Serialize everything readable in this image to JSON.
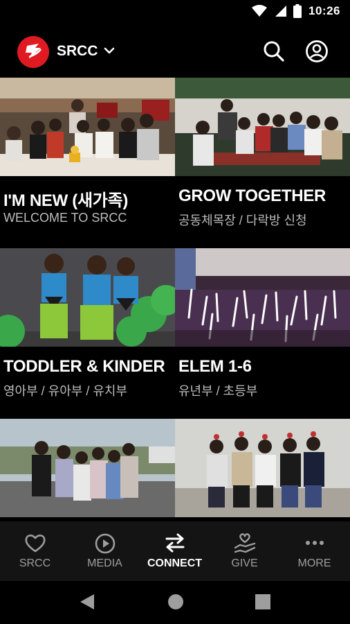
{
  "status_bar": {
    "time": "10:26"
  },
  "app_bar": {
    "app_name": "SRCC"
  },
  "cards": [
    {
      "title": "I'M NEW (새가족)",
      "subtitle": "WELCOME TO SRCC"
    },
    {
      "title": "GROW TOGETHER",
      "subtitle": "공동체목장 / 다락방 신청"
    },
    {
      "title": "TODDLER & KINDER",
      "subtitle": "영아부 / 유아부 / 유치부"
    },
    {
      "title": "ELEM 1-6",
      "subtitle": "유년부 / 초등부"
    },
    {
      "title": "",
      "subtitle": ""
    },
    {
      "title": "",
      "subtitle": ""
    }
  ],
  "bottom_nav": [
    {
      "label": "SRCC",
      "icon": "heart-icon"
    },
    {
      "label": "MEDIA",
      "icon": "play-icon"
    },
    {
      "label": "CONNECT",
      "icon": "swap-arrows-icon",
      "active": true
    },
    {
      "label": "GIVE",
      "icon": "hand-heart-icon"
    },
    {
      "label": "MORE",
      "icon": "more-dots-icon"
    }
  ],
  "colors": {
    "background": "#000000",
    "logo": "#e01a22",
    "nav_bar": "#141414",
    "subtitle": "#bdbdbd",
    "nav_inactive": "#9e9e9e"
  }
}
